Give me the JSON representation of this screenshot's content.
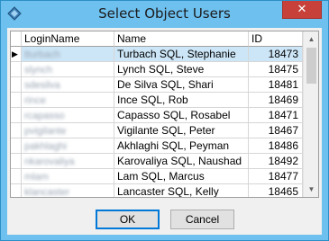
{
  "window": {
    "title": "Select Object Users",
    "close_glyph": "✕",
    "icon": "app-diamond-icon"
  },
  "grid": {
    "columns": [
      "LoginName",
      "Name",
      "ID"
    ],
    "rows": [
      {
        "login": "tturbach",
        "name": "Turbach SQL, Stephanie",
        "id": "18473",
        "selected": true
      },
      {
        "login": "slynch",
        "name": "Lynch SQL, Steve",
        "id": "18475"
      },
      {
        "login": "sdesilva",
        "name": "De Silva SQL, Shari",
        "id": "18481"
      },
      {
        "login": "rince",
        "name": "Ince SQL, Rob",
        "id": "18469"
      },
      {
        "login": "rcapasso",
        "name": "Capasso SQL, Rosabel",
        "id": "18471"
      },
      {
        "login": "pvigilante",
        "name": "Vigilante SQL, Peter",
        "id": "18467"
      },
      {
        "login": "pakhlaghi",
        "name": "Akhlaghi SQL, Peyman",
        "id": "18486"
      },
      {
        "login": "nkarovaliya",
        "name": "Karovaliya SQL, Naushad",
        "id": "18492"
      },
      {
        "login": "mlam",
        "name": "Lam SQL, Marcus",
        "id": "18477"
      },
      {
        "login": "klancaster",
        "name": "Lancaster SQL, Kelly",
        "id": "18465"
      }
    ],
    "row_pointer_glyph": "▶",
    "scroll_up_glyph": "▲",
    "scroll_down_glyph": "▼"
  },
  "buttons": {
    "ok": "OK",
    "cancel": "Cancel"
  }
}
